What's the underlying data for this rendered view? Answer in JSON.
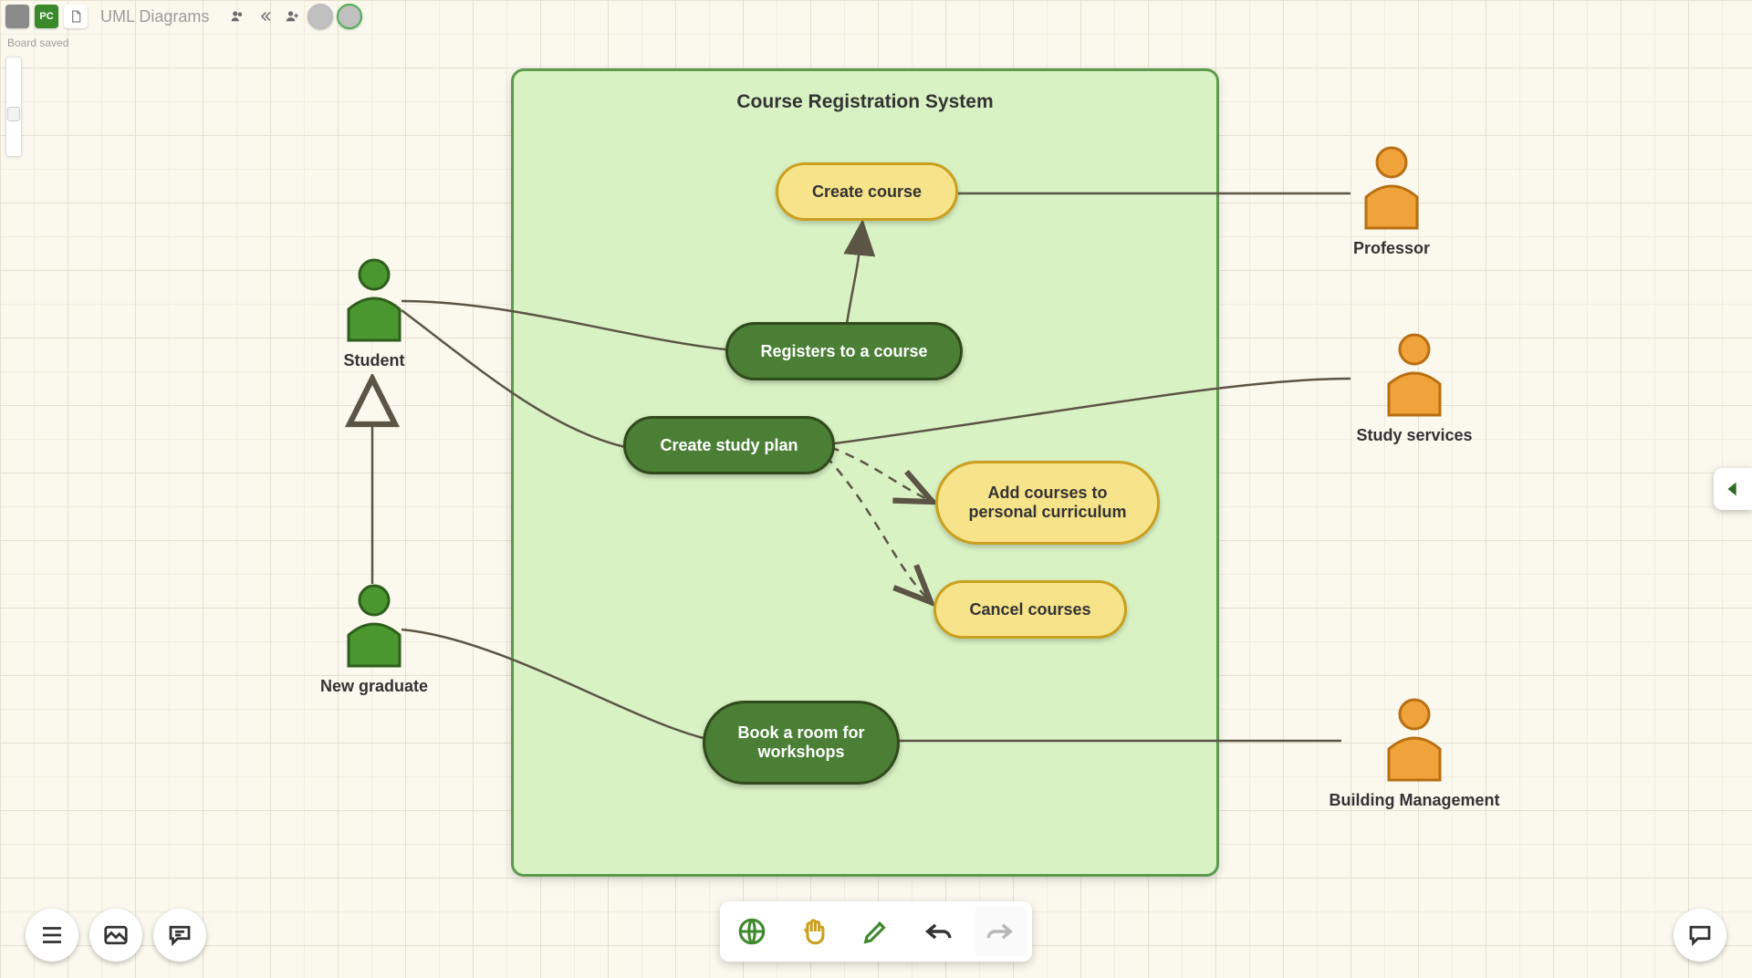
{
  "board": {
    "title": "UML Diagrams",
    "status": "Board saved",
    "owner_chip": "PC"
  },
  "system": {
    "title": "Course Registration System"
  },
  "actors": {
    "student": "Student",
    "new_graduate": "New graduate",
    "professor": "Professor",
    "study_services": "Study services",
    "building_management": "Building Management"
  },
  "usecases": {
    "create_course": "Create course",
    "registers_course": "Registers to a course",
    "create_study_plan": "Create study plan",
    "add_courses": "Add courses to personal curriculum",
    "cancel_courses": "Cancel courses",
    "book_room": "Book a room for workshops"
  },
  "toolbar_center": {
    "globe": "minimap",
    "hand": "pan",
    "pen": "draw",
    "undo": "undo",
    "redo": "redo"
  },
  "toolbar_left": {
    "menu": "menu",
    "image": "image",
    "comment": "comment"
  },
  "colors": {
    "actor_left": "#3a892a",
    "actor_right": "#e08a2a",
    "uc_yellow_fill": "#f6e38a",
    "uc_yellow_border": "#caa01e",
    "uc_green_fill": "#4a7f35",
    "uc_green_border": "#314a1c",
    "system_fill": "#d9f2c4",
    "system_border": "#5c9b4f",
    "connector": "#5c5545"
  }
}
